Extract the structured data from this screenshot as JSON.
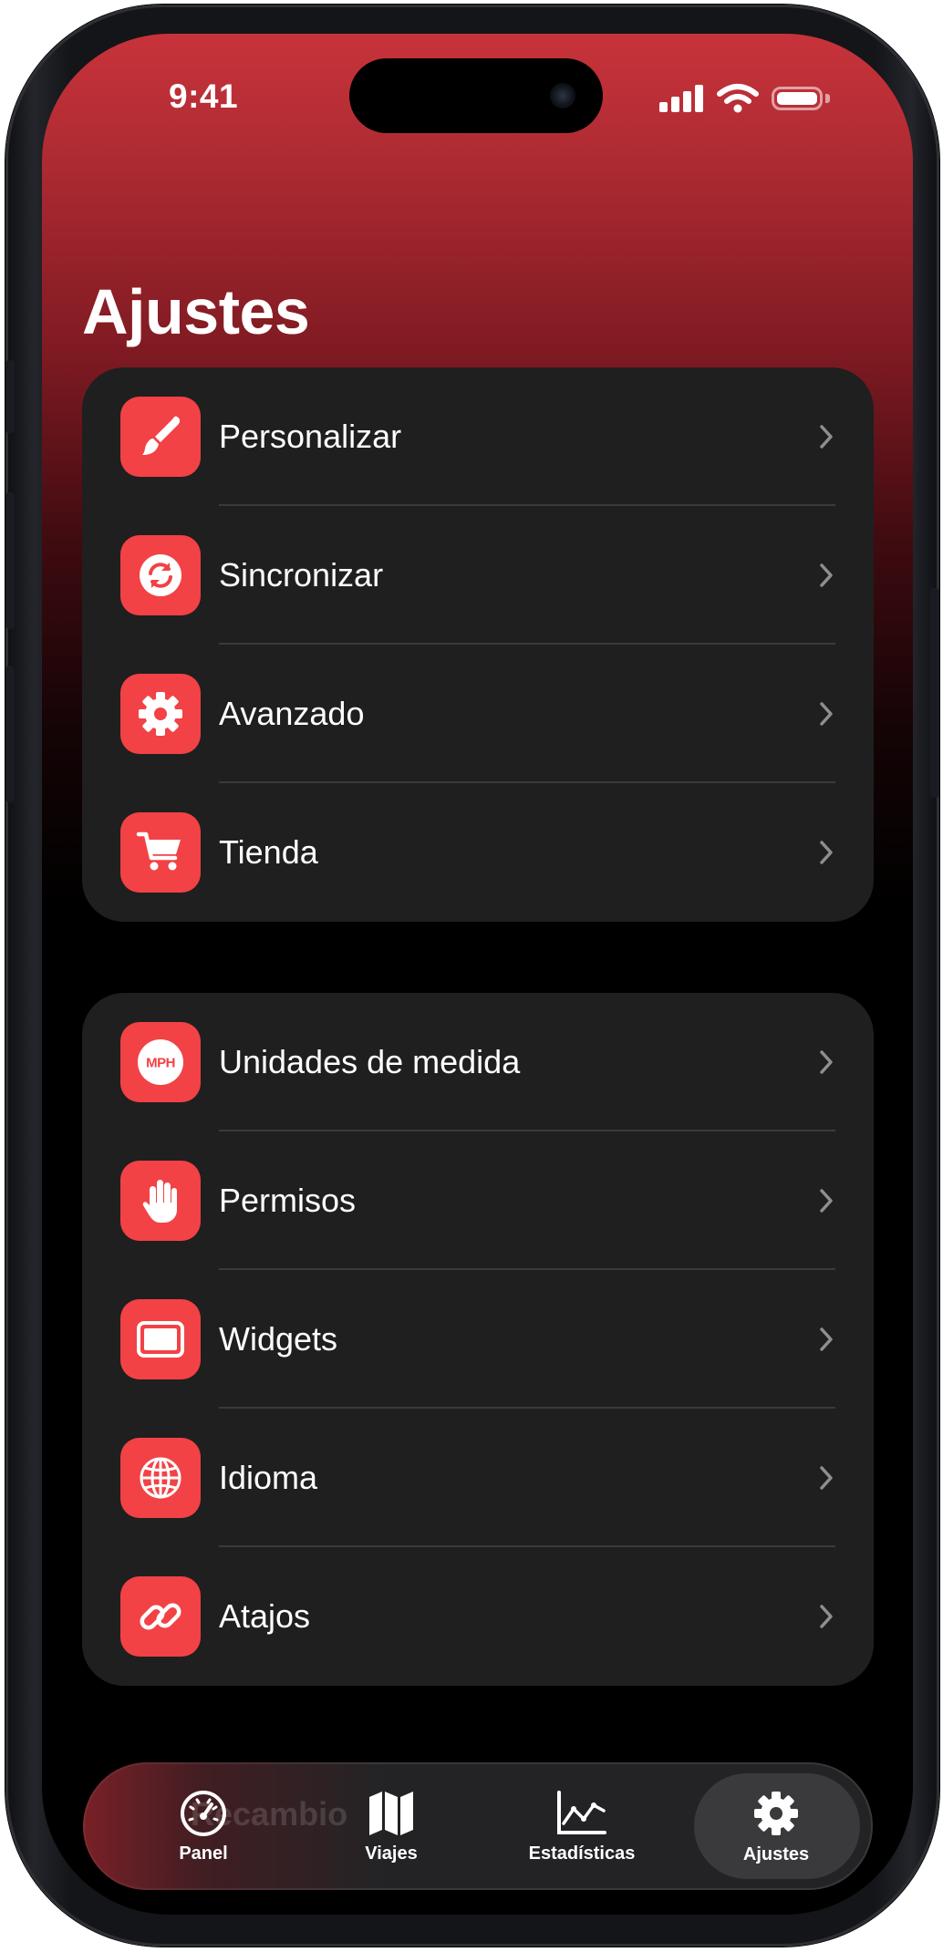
{
  "status_bar": {
    "time": "9:41"
  },
  "page": {
    "title": "Ajustes"
  },
  "groups": [
    {
      "items": [
        {
          "label": "Personalizar",
          "icon": "paintbrush-icon"
        },
        {
          "label": "Sincronizar",
          "icon": "sync-icon"
        },
        {
          "label": "Avanzado",
          "icon": "gear-icon"
        },
        {
          "label": "Tienda",
          "icon": "cart-icon"
        }
      ]
    },
    {
      "items": [
        {
          "label": "Unidades de medida",
          "icon": "mph-icon",
          "icon_text": "MPH"
        },
        {
          "label": "Permisos",
          "icon": "hand-icon"
        },
        {
          "label": "Widgets",
          "icon": "widget-icon"
        },
        {
          "label": "Idioma",
          "icon": "globe-icon"
        },
        {
          "label": "Atajos",
          "icon": "link-icon"
        }
      ]
    }
  ],
  "tab_bar": {
    "behind_text": "Recambio",
    "tabs": [
      {
        "label": "Panel",
        "icon": "speedometer-icon",
        "selected": false
      },
      {
        "label": "Viajes",
        "icon": "map-icon",
        "selected": false
      },
      {
        "label": "Estadísticas",
        "icon": "chart-icon",
        "selected": false
      },
      {
        "label": "Ajustes",
        "icon": "gear-icon",
        "selected": true
      }
    ]
  },
  "colors": {
    "accent": "#f24246",
    "group_bg": "#1f1f1f",
    "header_top": "#c8333a"
  }
}
